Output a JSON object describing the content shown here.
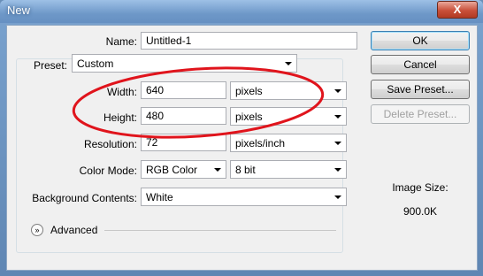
{
  "window": {
    "title": "New",
    "close_glyph": "X"
  },
  "form": {
    "name_label": "Name:",
    "name_value": "Untitled-1",
    "preset_label": "Preset:",
    "preset_value": "Custom",
    "width_label": "Width:",
    "width_value": "640",
    "width_unit": "pixels",
    "height_label": "Height:",
    "height_value": "480",
    "height_unit": "pixels",
    "resolution_label": "Resolution:",
    "resolution_value": "72",
    "resolution_unit": "pixels/inch",
    "color_mode_label": "Color Mode:",
    "color_mode_value": "RGB Color",
    "bit_depth_value": "8 bit",
    "background_label": "Background Contents:",
    "background_value": "White",
    "advanced_label": "Advanced",
    "advanced_glyph": "»"
  },
  "buttons": {
    "ok": "OK",
    "cancel": "Cancel",
    "save_preset": "Save Preset...",
    "delete_preset": "Delete Preset..."
  },
  "image_size": {
    "label": "Image Size:",
    "value": "900.0K"
  },
  "annotation": {
    "color": "#e0141c"
  },
  "colors": {
    "title_bar": "#6e98c8",
    "dialog_bg": "#f0f0f0",
    "close_button": "#c9503a"
  }
}
